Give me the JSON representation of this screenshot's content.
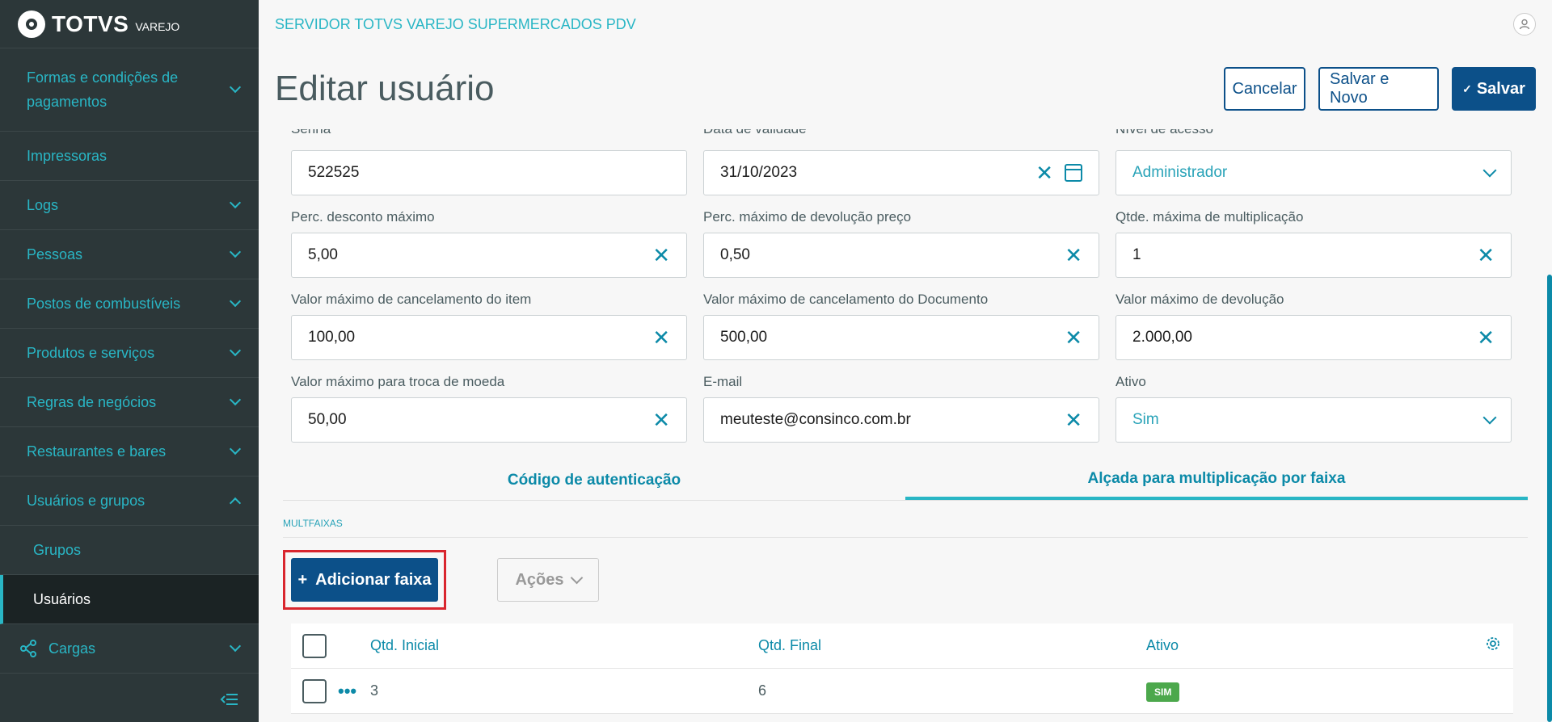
{
  "sidebar": {
    "brand": "TOTVS",
    "brand_sub": "VAREJO",
    "items": [
      {
        "label": "Formas e condições de pagamentos"
      },
      {
        "label": "Impressoras"
      },
      {
        "label": "Logs"
      },
      {
        "label": "Pessoas"
      },
      {
        "label": "Postos de combustíveis"
      },
      {
        "label": "Produtos e serviços"
      },
      {
        "label": "Regras de negócios"
      },
      {
        "label": "Restaurantes e bares"
      },
      {
        "label": "Usuários e grupos"
      },
      {
        "label": "Grupos"
      },
      {
        "label": "Usuários"
      },
      {
        "label": "Cargas"
      }
    ]
  },
  "topbar": {
    "server_title": "SERVIDOR TOTVS VAREJO SUPERMERCADOS PDV"
  },
  "header": {
    "title": "Editar usuário",
    "cancel": "Cancelar",
    "save_new": "Salvar e Novo",
    "save": "Salvar",
    "save_check": "✓"
  },
  "form": {
    "senha_label": "Senha",
    "senha": "522525",
    "validade_label": "Data de validade",
    "validade": "31/10/2023",
    "nivel_label": "Nível de acesso",
    "nivel": "Administrador",
    "desconto_label": "Perc. desconto máximo",
    "desconto": "5,00",
    "devolucao_preco_label": "Perc. máximo de devolução preço",
    "devolucao_preco": "0,50",
    "multiplicacao_label": "Qtde. máxima de multiplicação",
    "multiplicacao": "1",
    "canc_item_label": "Valor máximo de cancelamento do item",
    "canc_item": "100,00",
    "canc_doc_label": "Valor máximo de cancelamento do Documento",
    "canc_doc": "500,00",
    "devolucao_label": "Valor máximo de devolução",
    "devolucao": "2.000,00",
    "troca_label": "Valor máximo para troca de moeda",
    "troca": "50,00",
    "email_label": "E-mail",
    "email": "meuteste@consinco.com.br",
    "ativo_label": "Ativo",
    "ativo": "Sim"
  },
  "tabs": [
    "Código de autenticação",
    "Alçada para multiplicação por faixa"
  ],
  "section": {
    "label": "MULTFAIXAS"
  },
  "buttons": {
    "add": "Adicionar faixa",
    "add_plus": "+",
    "acoes": "Ações"
  },
  "table": {
    "headers": [
      "Qtd. Inicial",
      "Qtd. Final",
      "Ativo"
    ],
    "rows": [
      {
        "inicial": "3",
        "final": "6",
        "ativo": "SIM",
        "dots": "•••"
      }
    ]
  },
  "colors": {
    "accent": "#29b6c5",
    "primary": "#0c5089",
    "sidebar": "#2c3739",
    "highlight": "#d9262e"
  },
  "icons": [
    "chevron-down-icon",
    "chevron-up-icon",
    "user-icon",
    "close-icon",
    "calendar-icon",
    "share-icon",
    "collapse-menu-icon",
    "gear-icon",
    "check-icon"
  ]
}
